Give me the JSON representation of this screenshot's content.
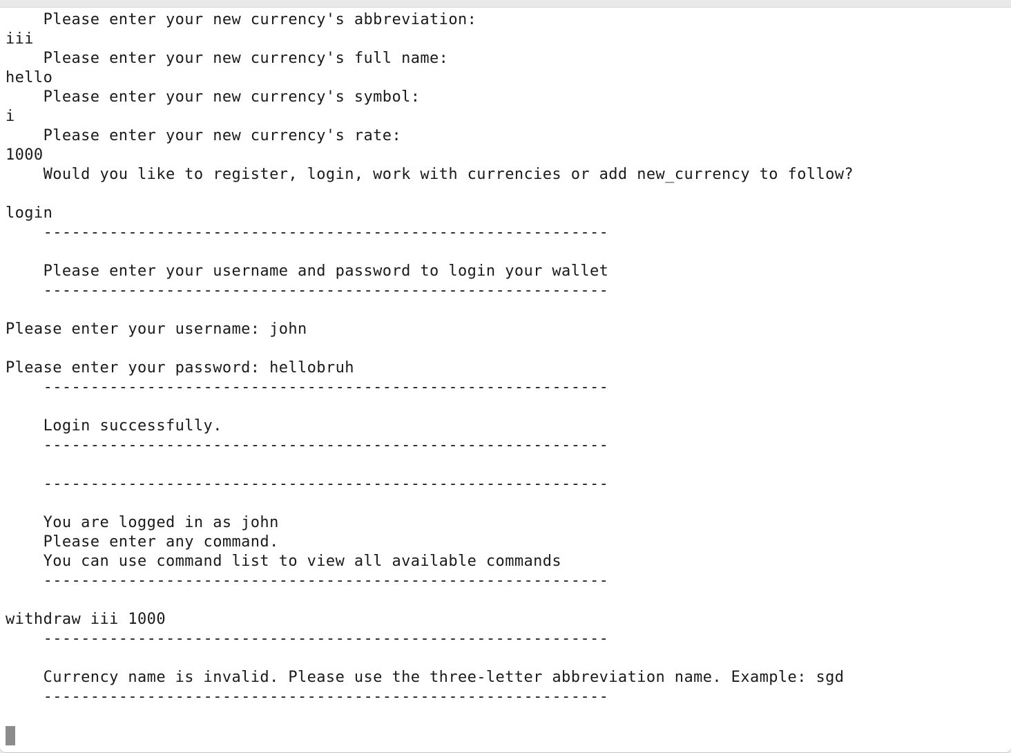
{
  "terminal": {
    "lines": [
      "    Please enter your new currency's abbreviation:",
      "iii",
      "    Please enter your new currency's full name:",
      "hello",
      "    Please enter your new currency's symbol:",
      "i",
      "    Please enter your new currency's rate:",
      "1000",
      "    Would you like to register, login, work with currencies or add new_currency to follow?",
      "",
      "login",
      "    ------------------------------------------------------------",
      "",
      "    Please enter your username and password to login your wallet",
      "    ------------------------------------------------------------",
      "",
      "Please enter your username: john",
      "",
      "Please enter your password: hellobruh",
      "    ------------------------------------------------------------",
      "",
      "    Login successfully.",
      "    ------------------------------------------------------------",
      "",
      "    ------------------------------------------------------------",
      "",
      "    You are logged in as john",
      "    Please enter any command.",
      "    You can use command list to view all available commands",
      "    ------------------------------------------------------------",
      "",
      "withdraw iii 1000",
      "    ------------------------------------------------------------",
      "",
      "    Currency name is invalid. Please use the three-letter abbreviation name. Example: sgd",
      "    ------------------------------------------------------------"
    ]
  }
}
